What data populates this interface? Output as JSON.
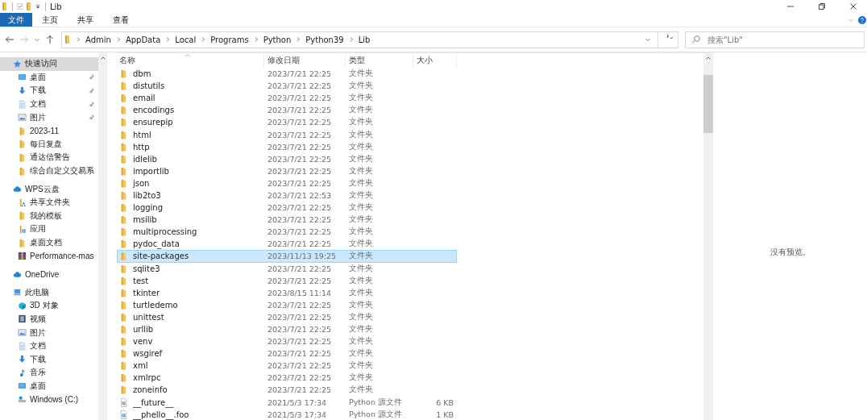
{
  "window": {
    "title": "Lib"
  },
  "ribbon": {
    "tabs": [
      {
        "label": "文件",
        "selected": true
      },
      {
        "label": "主页",
        "selected": false
      },
      {
        "label": "共享",
        "selected": false
      },
      {
        "label": "查看",
        "selected": false
      }
    ]
  },
  "address": {
    "path": [
      "Admin",
      "AppData",
      "Local",
      "Programs",
      "Python",
      "Python39",
      "Lib"
    ]
  },
  "search": {
    "placeholder": "搜索\"Lib\""
  },
  "sidebar": {
    "groups": [
      {
        "label": "快速访问",
        "kind": "star",
        "selected": true,
        "children": [
          {
            "label": "桌面",
            "kind": "desktop",
            "pinned": true
          },
          {
            "label": "下载",
            "kind": "download",
            "pinned": true
          },
          {
            "label": "文档",
            "kind": "document",
            "pinned": true
          },
          {
            "label": "图片",
            "kind": "pictures",
            "pinned": true
          },
          {
            "label": "2023-11",
            "kind": "folder",
            "pinned": false
          },
          {
            "label": "每日复盘",
            "kind": "folder",
            "pinned": false
          },
          {
            "label": "通达信警告",
            "kind": "folder",
            "pinned": false
          },
          {
            "label": "综合自定义交易系",
            "kind": "folder",
            "pinned": false
          }
        ]
      },
      {
        "label": "WPS云盘",
        "kind": "cloud",
        "selected": false,
        "children": [
          {
            "label": "共享文件夹",
            "kind": "shared",
            "pinned": false
          },
          {
            "label": "我的模板",
            "kind": "folder",
            "pinned": false
          },
          {
            "label": "应用",
            "kind": "apps",
            "pinned": false
          },
          {
            "label": "桌面文档",
            "kind": "folder",
            "pinned": false
          },
          {
            "label": "Performance-mas",
            "kind": "archive",
            "pinned": false
          }
        ]
      },
      {
        "label": "OneDrive",
        "kind": "cloud",
        "selected": false
      },
      {
        "label": "此电脑",
        "kind": "computer",
        "selected": false,
        "children": [
          {
            "label": "3D 对象",
            "kind": "cube",
            "pinned": false
          },
          {
            "label": "视频",
            "kind": "video",
            "pinned": false
          },
          {
            "label": "图片",
            "kind": "pictures",
            "pinned": false
          },
          {
            "label": "文档",
            "kind": "document",
            "pinned": false
          },
          {
            "label": "下载",
            "kind": "download",
            "pinned": false
          },
          {
            "label": "音乐",
            "kind": "music",
            "pinned": false
          },
          {
            "label": "桌面",
            "kind": "desktop",
            "pinned": false
          },
          {
            "label": "Windows (C:)",
            "kind": "drive",
            "pinned": false
          }
        ]
      }
    ]
  },
  "table": {
    "columns": [
      "名称",
      "修改日期",
      "类型",
      "大小"
    ],
    "rows": [
      {
        "kind": "folder",
        "name": "dbm",
        "date": "2023/7/21 22:25",
        "type": "文件夹",
        "selected": false
      },
      {
        "kind": "folder",
        "name": "distutils",
        "date": "2023/7/21 22:25",
        "type": "文件夹",
        "selected": false
      },
      {
        "kind": "folder",
        "name": "email",
        "date": "2023/7/21 22:25",
        "type": "文件夹",
        "selected": false
      },
      {
        "kind": "folder",
        "name": "encodings",
        "date": "2023/7/21 22:25",
        "type": "文件夹",
        "selected": false
      },
      {
        "kind": "folder",
        "name": "ensurepip",
        "date": "2023/7/21 22:25",
        "type": "文件夹",
        "selected": false
      },
      {
        "kind": "folder",
        "name": "html",
        "date": "2023/7/21 22:25",
        "type": "文件夹",
        "selected": false
      },
      {
        "kind": "folder",
        "name": "http",
        "date": "2023/7/21 22:25",
        "type": "文件夹",
        "selected": false
      },
      {
        "kind": "folder",
        "name": "idlelib",
        "date": "2023/7/21 22:25",
        "type": "文件夹",
        "selected": false
      },
      {
        "kind": "folder",
        "name": "importlib",
        "date": "2023/7/21 22:25",
        "type": "文件夹",
        "selected": false
      },
      {
        "kind": "folder",
        "name": "json",
        "date": "2023/7/21 22:25",
        "type": "文件夹",
        "selected": false
      },
      {
        "kind": "folder",
        "name": "lib2to3",
        "date": "2023/7/21 22:53",
        "type": "文件夹",
        "selected": false
      },
      {
        "kind": "folder",
        "name": "logging",
        "date": "2023/7/21 22:25",
        "type": "文件夹",
        "selected": false
      },
      {
        "kind": "folder",
        "name": "msilib",
        "date": "2023/7/21 22:25",
        "type": "文件夹",
        "selected": false
      },
      {
        "kind": "folder",
        "name": "multiprocessing",
        "date": "2023/7/21 22:25",
        "type": "文件夹",
        "selected": false
      },
      {
        "kind": "folder",
        "name": "pydoc_data",
        "date": "2023/7/21 22:25",
        "type": "文件夹",
        "selected": false
      },
      {
        "kind": "folder",
        "name": "site-packages",
        "date": "2023/11/13 19:25",
        "type": "文件夹",
        "selected": true
      },
      {
        "kind": "folder",
        "name": "sqlite3",
        "date": "2023/7/21 22:25",
        "type": "文件夹",
        "selected": false
      },
      {
        "kind": "folder",
        "name": "test",
        "date": "2023/7/21 22:25",
        "type": "文件夹",
        "selected": false
      },
      {
        "kind": "folder",
        "name": "tkinter",
        "date": "2023/8/15 11:14",
        "type": "文件夹",
        "selected": false
      },
      {
        "kind": "folder",
        "name": "turtledemo",
        "date": "2023/7/21 22:25",
        "type": "文件夹",
        "selected": false
      },
      {
        "kind": "folder",
        "name": "unittest",
        "date": "2023/7/21 22:25",
        "type": "文件夹",
        "selected": false
      },
      {
        "kind": "folder",
        "name": "urllib",
        "date": "2023/7/21 22:25",
        "type": "文件夹",
        "selected": false
      },
      {
        "kind": "folder",
        "name": "venv",
        "date": "2023/7/21 22:25",
        "type": "文件夹",
        "selected": false
      },
      {
        "kind": "folder",
        "name": "wsgiref",
        "date": "2023/7/21 22:25",
        "type": "文件夹",
        "selected": false
      },
      {
        "kind": "folder",
        "name": "xml",
        "date": "2023/7/21 22:25",
        "type": "文件夹",
        "selected": false
      },
      {
        "kind": "folder",
        "name": "xmlrpc",
        "date": "2023/7/21 22:25",
        "type": "文件夹",
        "selected": false
      },
      {
        "kind": "folder",
        "name": "zoneinfo",
        "date": "2023/7/21 22:25",
        "type": "文件夹",
        "selected": false
      },
      {
        "kind": "python",
        "name": "__future__",
        "date": "2021/5/3 17:34",
        "type": "Python 源文件",
        "size": "6 KB",
        "selected": false
      },
      {
        "kind": "python",
        "name": "__phello__.foo",
        "date": "2021/5/3 17:34",
        "type": "Python 源文件",
        "size": "1 KB",
        "selected": false
      }
    ]
  },
  "preview": {
    "message": "没有预览。"
  }
}
